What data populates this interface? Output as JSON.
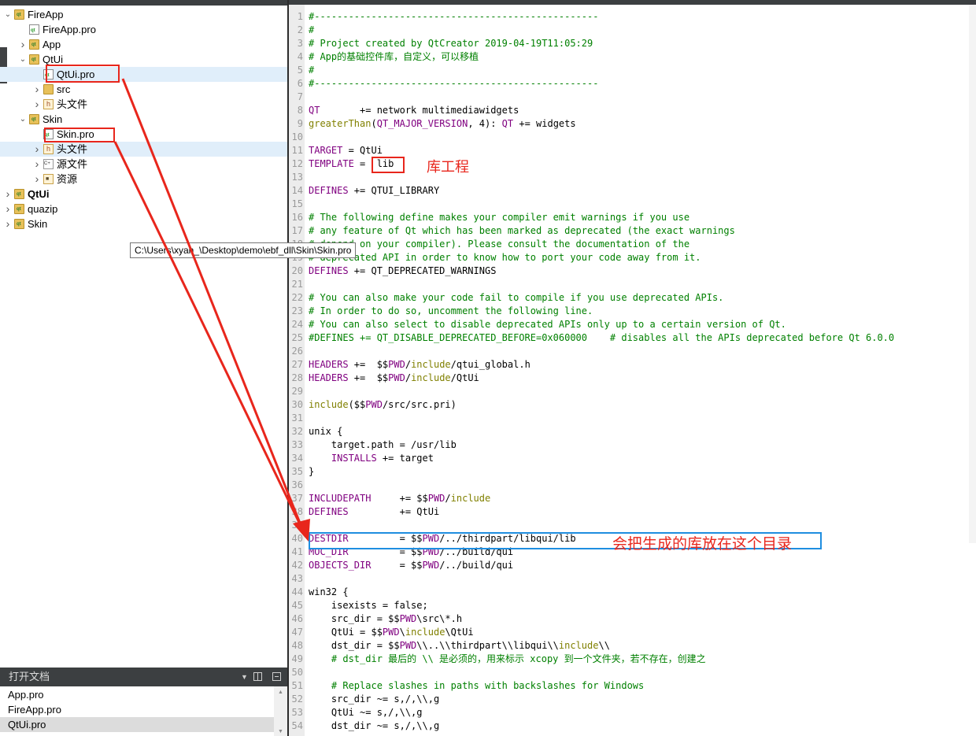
{
  "project_tree": {
    "items": [
      {
        "label": "FireApp",
        "level": 0,
        "expanded": true,
        "icon": "qt-folder-icon",
        "bold": false
      },
      {
        "label": "FireApp.pro",
        "level": 1,
        "icon": "pro-file-icon"
      },
      {
        "label": "App",
        "level": 1,
        "expanded": false,
        "icon": "qt-folder-icon"
      },
      {
        "label": "QtUi",
        "level": 1,
        "expanded": true,
        "icon": "qt-folder-icon"
      },
      {
        "label": "QtUi.pro",
        "level": 2,
        "icon": "pro-file-icon",
        "highlighted": true
      },
      {
        "label": "src",
        "level": 2,
        "expanded": false,
        "icon": "folder-icon"
      },
      {
        "label": "头文件",
        "level": 2,
        "expanded": false,
        "icon": "header-folder-icon"
      },
      {
        "label": "Skin",
        "level": 1,
        "expanded": true,
        "icon": "qt-folder-icon"
      },
      {
        "label": "Skin.pro",
        "level": 2,
        "icon": "pro-file-icon"
      },
      {
        "label": "头文件",
        "level": 2,
        "expanded": false,
        "icon": "header-folder-icon",
        "highlighted": true
      },
      {
        "label": "源文件",
        "level": 2,
        "expanded": false,
        "icon": "source-folder-icon"
      },
      {
        "label": "资源",
        "level": 2,
        "expanded": false,
        "icon": "resource-folder-icon"
      },
      {
        "label": "QtUi",
        "level": 0,
        "expanded": false,
        "icon": "qt-folder-icon",
        "bold": true
      },
      {
        "label": "quazip",
        "level": 0,
        "expanded": false,
        "icon": "qt-folder-icon"
      },
      {
        "label": "Skin",
        "level": 0,
        "expanded": false,
        "icon": "qt-folder-icon"
      }
    ],
    "tooltip": "C:\\Users\\xyan_\\Desktop\\demo\\ebf_dll\\Skin\\Skin.pro"
  },
  "open_documents": {
    "title": "打开文档",
    "items": [
      "App.pro",
      "FireApp.pro",
      "QtUi.pro"
    ],
    "selected_index": 2
  },
  "editor": {
    "first_line": 1,
    "lines": [
      [
        {
          "t": "#--------------------------------------------------",
          "c": "cm"
        }
      ],
      [
        {
          "t": "#",
          "c": "cm"
        }
      ],
      [
        {
          "t": "# Project created by QtCreator 2019-04-19T11:05:29",
          "c": "cm"
        }
      ],
      [
        {
          "t": "# App的基础控件库，自定义，可以移植",
          "c": "cm"
        }
      ],
      [
        {
          "t": "#",
          "c": "cm"
        }
      ],
      [
        {
          "t": "#--------------------------------------------------",
          "c": "cm"
        }
      ],
      [],
      [
        {
          "t": "QT",
          "c": "mac"
        },
        {
          "t": "       += network multimediawidgets",
          "c": ""
        }
      ],
      [
        {
          "t": "greaterThan",
          "c": "kw"
        },
        {
          "t": "(",
          "c": ""
        },
        {
          "t": "QT_MAJOR_VERSION",
          "c": "mac"
        },
        {
          "t": ", 4): ",
          "c": ""
        },
        {
          "t": "QT",
          "c": "mac"
        },
        {
          "t": " += widgets",
          "c": ""
        }
      ],
      [],
      [
        {
          "t": "TARGET",
          "c": "mac"
        },
        {
          "t": " = QtUi",
          "c": ""
        }
      ],
      [
        {
          "t": "TEMPLATE",
          "c": "mac"
        },
        {
          "t": " =  lib",
          "c": ""
        }
      ],
      [],
      [
        {
          "t": "DEFINES",
          "c": "mac"
        },
        {
          "t": " += QTUI_LIBRARY",
          "c": ""
        }
      ],
      [],
      [
        {
          "t": "# The following define makes your compiler emit warnings if you use",
          "c": "cm"
        }
      ],
      [
        {
          "t": "# any feature of Qt which has been marked as deprecated (the exact warnings",
          "c": "cm"
        }
      ],
      [
        {
          "t": "# depend on your compiler). Please consult the documentation of the",
          "c": "cm"
        }
      ],
      [
        {
          "t": "# deprecated API in order to know how to port your code away from it.",
          "c": "cm"
        }
      ],
      [
        {
          "t": "DEFINES",
          "c": "mac"
        },
        {
          "t": " += QT_DEPRECATED_WARNINGS",
          "c": ""
        }
      ],
      [],
      [
        {
          "t": "# You can also make your code fail to compile if you use deprecated APIs.",
          "c": "cm"
        }
      ],
      [
        {
          "t": "# In order to do so, uncomment the following line.",
          "c": "cm"
        }
      ],
      [
        {
          "t": "# You can also select to disable deprecated APIs only up to a certain version of Qt.",
          "c": "cm"
        }
      ],
      [
        {
          "t": "#DEFINES += QT_DISABLE_DEPRECATED_BEFORE=0x060000    # disables all the APIs deprecated before Qt 6.0.0",
          "c": "cm"
        }
      ],
      [],
      [
        {
          "t": "HEADERS",
          "c": "mac"
        },
        {
          "t": " +=  $$",
          "c": ""
        },
        {
          "t": "PWD",
          "c": "mac"
        },
        {
          "t": "/",
          "c": ""
        },
        {
          "t": "include",
          "c": "kw"
        },
        {
          "t": "/qtui_global.h",
          "c": ""
        }
      ],
      [
        {
          "t": "HEADERS",
          "c": "mac"
        },
        {
          "t": " +=  $$",
          "c": ""
        },
        {
          "t": "PWD",
          "c": "mac"
        },
        {
          "t": "/",
          "c": ""
        },
        {
          "t": "include",
          "c": "kw"
        },
        {
          "t": "/QtUi",
          "c": ""
        }
      ],
      [],
      [
        {
          "t": "include",
          "c": "kw"
        },
        {
          "t": "($$",
          "c": ""
        },
        {
          "t": "PWD",
          "c": "mac"
        },
        {
          "t": "/src/src.pri)",
          "c": ""
        }
      ],
      [],
      [
        {
          "t": "unix {",
          "c": ""
        }
      ],
      [
        {
          "t": "    target.path = /usr/lib",
          "c": ""
        }
      ],
      [
        {
          "t": "    ",
          "c": ""
        },
        {
          "t": "INSTALLS",
          "c": "mac"
        },
        {
          "t": " += target",
          "c": ""
        }
      ],
      [
        {
          "t": "}",
          "c": ""
        }
      ],
      [],
      [
        {
          "t": "INCLUDEPATH",
          "c": "mac"
        },
        {
          "t": "     += $$",
          "c": ""
        },
        {
          "t": "PWD",
          "c": "mac"
        },
        {
          "t": "/",
          "c": ""
        },
        {
          "t": "include",
          "c": "kw"
        }
      ],
      [
        {
          "t": "DEFINES",
          "c": "mac"
        },
        {
          "t": "         += QtUi",
          "c": ""
        }
      ],
      [],
      [
        {
          "t": "DESTDIR",
          "c": "mac"
        },
        {
          "t": "         = $$",
          "c": ""
        },
        {
          "t": "PWD",
          "c": "mac"
        },
        {
          "t": "/../thirdpart/libqui/lib",
          "c": ""
        }
      ],
      [
        {
          "t": "MOC_DIR",
          "c": "mac"
        },
        {
          "t": "         = $$",
          "c": ""
        },
        {
          "t": "PWD",
          "c": "mac"
        },
        {
          "t": "/../build/qui",
          "c": ""
        }
      ],
      [
        {
          "t": "OBJECTS_DIR",
          "c": "mac"
        },
        {
          "t": "     = $$",
          "c": ""
        },
        {
          "t": "PWD",
          "c": "mac"
        },
        {
          "t": "/../build/qui",
          "c": ""
        }
      ],
      [],
      [
        {
          "t": "win32 {",
          "c": ""
        }
      ],
      [
        {
          "t": "    isexists = false;",
          "c": ""
        }
      ],
      [
        {
          "t": "    src_dir = $$",
          "c": ""
        },
        {
          "t": "PWD",
          "c": "mac"
        },
        {
          "t": "\\src\\*.h",
          "c": ""
        }
      ],
      [
        {
          "t": "    QtUi = $$",
          "c": ""
        },
        {
          "t": "PWD",
          "c": "mac"
        },
        {
          "t": "\\",
          "c": ""
        },
        {
          "t": "include",
          "c": "kw"
        },
        {
          "t": "\\QtUi",
          "c": ""
        }
      ],
      [
        {
          "t": "    dst_dir = $$",
          "c": ""
        },
        {
          "t": "PWD",
          "c": "mac"
        },
        {
          "t": "\\\\..\\\\thirdpart\\\\libqui\\\\",
          "c": ""
        },
        {
          "t": "include",
          "c": "kw"
        },
        {
          "t": "\\\\",
          "c": ""
        }
      ],
      [
        {
          "t": "    # dst_dir 最后的 \\\\ 是必须的，用来标示 xcopy 到一个文件夹，若不存在，创建之",
          "c": "cm"
        }
      ],
      [],
      [
        {
          "t": "    # Replace slashes in paths with backslashes for Windows",
          "c": "cm"
        }
      ],
      [
        {
          "t": "    src_dir ~= s,/,\\\\,g",
          "c": ""
        }
      ],
      [
        {
          "t": "    QtUi ~= s,/,\\\\,g",
          "c": ""
        }
      ],
      [
        {
          "t": "    dst_dir ~= s,/,\\\\,g",
          "c": ""
        }
      ]
    ]
  },
  "annotations": {
    "lib_label": "库工程",
    "destdir_label": "会把生成的库放在这个目录",
    "colors": {
      "red": "#e8261c",
      "blue": "#1f8ee0"
    }
  }
}
